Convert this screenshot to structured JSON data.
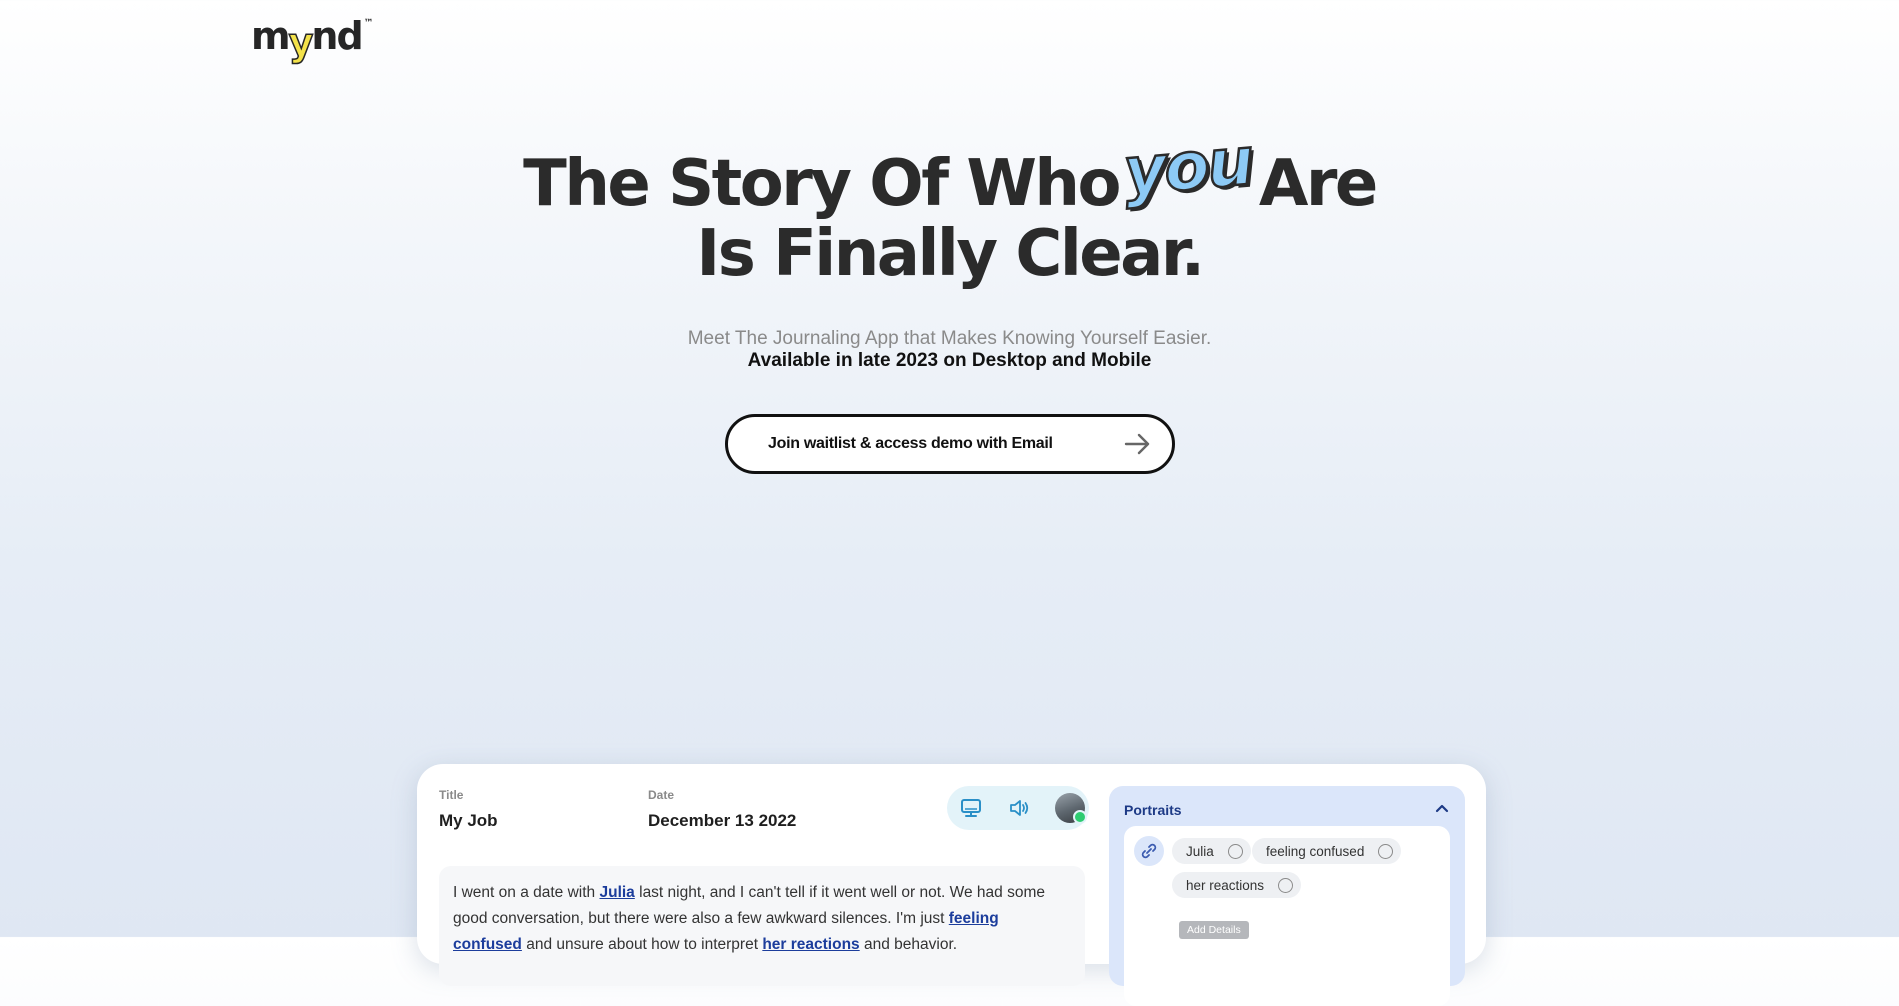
{
  "brand": {
    "logo_prefix": "m",
    "logo_y": "y",
    "logo_suffix": "nd",
    "trademark": "™"
  },
  "hero": {
    "title_part1": "The Story Of Who",
    "title_highlight": "you",
    "title_part2": "Are",
    "title_line2": "Is Finally Clear.",
    "subtitle": "Meet The Journaling App that Makes Knowing Yourself Easier.",
    "availability": "Available in late 2023 on Desktop and Mobile"
  },
  "cta": {
    "label": "Join waitlist & access demo with Email",
    "icon": "arrow-right-icon"
  },
  "demo": {
    "title_label": "Title",
    "title_value": "My Job",
    "date_label": "Date",
    "date_value": "December 13 2022",
    "toolbar_icons": [
      "monitor-icon",
      "speaker-icon",
      "avatar"
    ],
    "journal": {
      "t1": "I went on a date with ",
      "h1": "Julia",
      "t2": " last night, and I can't tell if it went well or not. We had some good conversation, but there were also a few awkward silences. I'm just ",
      "h2": "feeling confused",
      "t3": " and unsure about how to interpret ",
      "h3": "her reactions",
      "t4": " and behavior."
    },
    "portraits": {
      "title": "Portraits",
      "chips": [
        "Julia",
        "feeling confused",
        "her reactions"
      ],
      "add_details": "Add Details"
    }
  },
  "colors": {
    "accent_blue": "#8dcaf5",
    "logo_yellow": "#f3e24a",
    "highlight_text": "#1c3d9c",
    "status_online": "#2ecc71"
  }
}
